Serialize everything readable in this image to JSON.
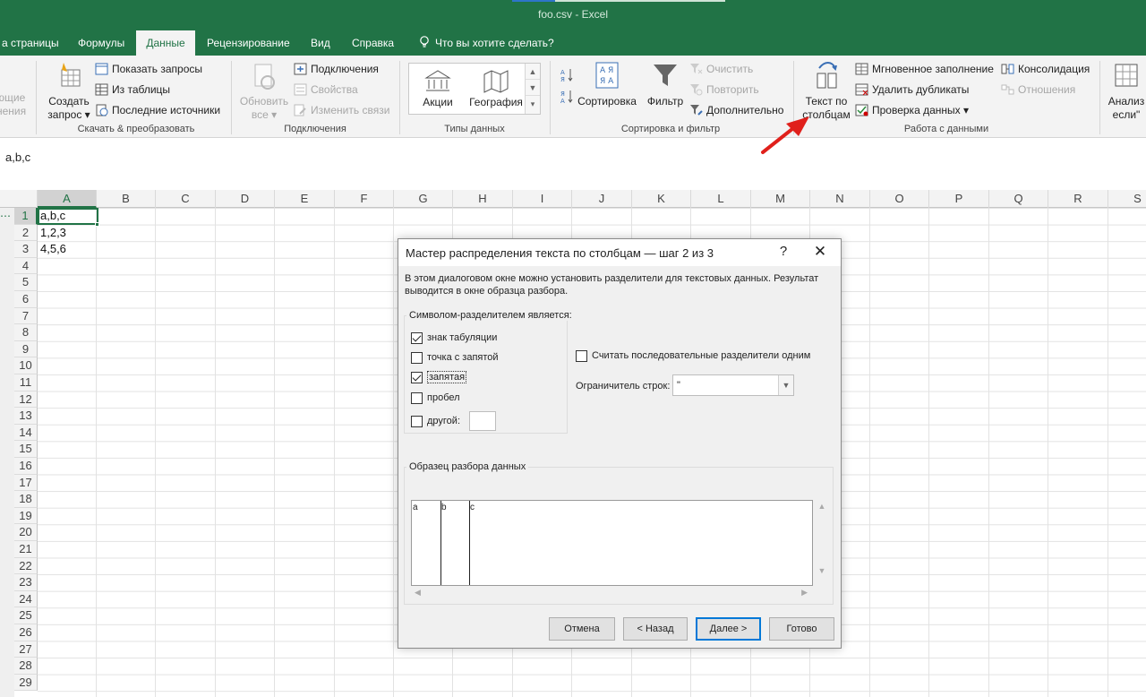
{
  "window": {
    "title": "foo.csv  -  Excel"
  },
  "tabs": [
    {
      "label": "а страницы"
    },
    {
      "label": "Формулы"
    },
    {
      "label": "Данные",
      "active": true
    },
    {
      "label": "Рецензирование"
    },
    {
      "label": "Вид"
    },
    {
      "label": "Справка"
    }
  ],
  "tellme": {
    "label": "Что вы хотите сделать?"
  },
  "ribbon": {
    "partial_left": {
      "line1": "ющие",
      "line2": "нения"
    },
    "get_transform": {
      "create_query": {
        "line1": "Создать",
        "line2": "запрос ▾"
      },
      "show_queries": "Показать запросы",
      "from_table": "Из таблицы",
      "recent_sources": "Последние источники",
      "group_label": "Скачать & преобразовать"
    },
    "connections": {
      "refresh_all": {
        "line1": "Обновить",
        "line2": "все ▾"
      },
      "connections": "Подключения",
      "properties": "Свойства",
      "edit_links": "Изменить связи",
      "group_label": "Подключения"
    },
    "data_types": {
      "stocks": "Акции",
      "geography": "География",
      "group_label": "Типы данных"
    },
    "sort_filter": {
      "sort": "Сортировка",
      "filter": "Фильтр",
      "clear": "Очистить",
      "reapply": "Повторить",
      "advanced": "Дополнительно",
      "group_label": "Сортировка и фильтр"
    },
    "data_tools": {
      "text_to_columns": {
        "line1": "Текст по",
        "line2": "столбцам"
      },
      "flash_fill": "Мгновенное заполнение",
      "remove_duplicates": "Удалить дубликаты",
      "data_validation": "Проверка данных  ▾",
      "consolidate": "Консолидация",
      "relationships": "Отношения",
      "group_label": "Работа с данными"
    },
    "partial_right": {
      "line1": "Анализ",
      "line2": "если\""
    }
  },
  "formula_bar": {
    "value": "a,b,c"
  },
  "grid": {
    "columns": [
      "A",
      "B",
      "C",
      "D",
      "E",
      "F",
      "G",
      "H",
      "I",
      "J",
      "K",
      "L",
      "M",
      "N",
      "O",
      "P",
      "Q",
      "R",
      "S"
    ],
    "rows": [
      "1",
      "2",
      "3",
      "4",
      "5",
      "6",
      "7",
      "8",
      "9",
      "10",
      "11",
      "12",
      "13",
      "14",
      "15",
      "16",
      "17",
      "18",
      "19",
      "20",
      "21",
      "22",
      "23",
      "24",
      "25",
      "26",
      "27",
      "28",
      "29"
    ],
    "cells": [
      {
        "ref": "A1",
        "value": "a,b,c"
      },
      {
        "ref": "A2",
        "value": "1,2,3"
      },
      {
        "ref": "A3",
        "value": "4,5,6"
      }
    ],
    "left_marker": "⋯"
  },
  "dialog": {
    "title": "Мастер распределения текста по столбцам — шаг 2 из 3",
    "help": "?",
    "close": "✕",
    "description": "В этом диалоговом окне можно установить разделители для текстовых данных. Результат выводится в окне образца разбора.",
    "delimiters_legend": "Символом-разделителем является:",
    "delimiters": [
      {
        "label": "знак табуляции",
        "checked": true
      },
      {
        "label": "точка с запятой",
        "checked": false
      },
      {
        "label": "запятая",
        "checked": true
      },
      {
        "label": "пробел",
        "checked": false
      },
      {
        "label": "другой:",
        "checked": false
      }
    ],
    "consecutive": {
      "label": "Считать последовательные разделители одним",
      "checked": false
    },
    "text_qualifier": {
      "label": "Ограничитель строк:",
      "value": "\""
    },
    "preview_legend": "Образец разбора данных",
    "preview_columns": [
      "a",
      "b",
      "c"
    ],
    "buttons": {
      "cancel": "Отмена",
      "back": "< Назад",
      "next": "Далее >",
      "finish": "Готово"
    }
  },
  "colors": {
    "excel_green": "#217346",
    "ribbon_bg": "#f3f3f3",
    "arrow_red": "#e0201b"
  }
}
